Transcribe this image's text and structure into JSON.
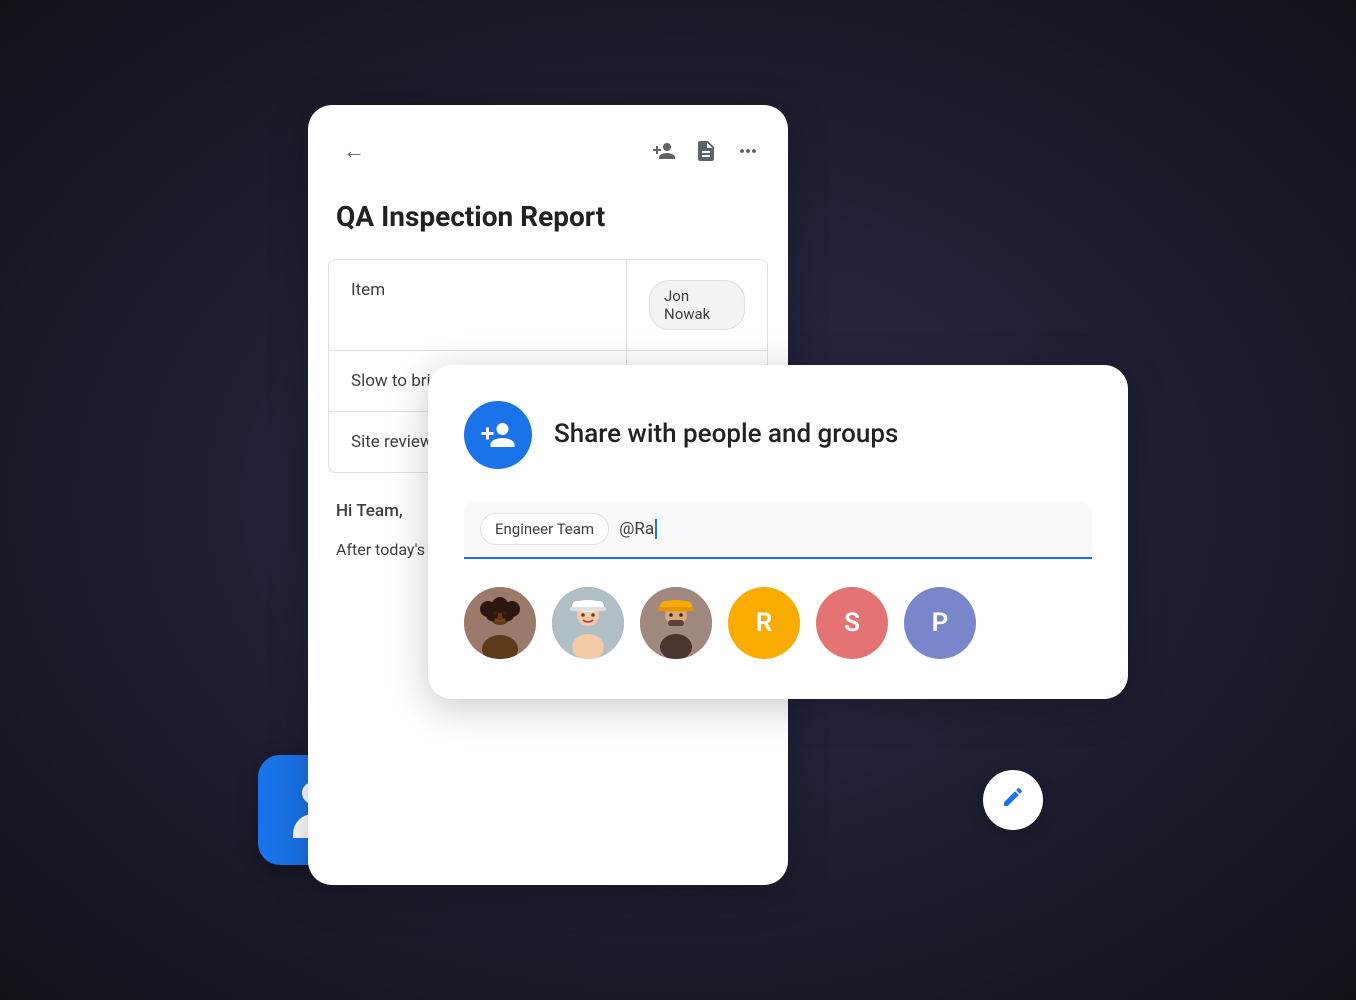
{
  "scene": {
    "background": "#1a1a2e"
  },
  "doc_card": {
    "title": "QA Inspection Report",
    "table": {
      "rows": [
        {
          "left": "Item",
          "right": "Jon Nowak"
        },
        {
          "left": "Slow to bri",
          "right": ""
        },
        {
          "left": "Site review",
          "right": ""
        }
      ]
    },
    "body": {
      "greeting": "Hi Team,",
      "text": "After today's please add y working doc before next week."
    },
    "fab_label": "✏"
  },
  "share_dialog": {
    "title": "Share with people and groups",
    "input": {
      "tag": "Engineer Team",
      "typed": "@Ra"
    },
    "avatars": [
      {
        "type": "photo",
        "id": "avatar1",
        "label": "Person 1",
        "color": "#bdbdbd"
      },
      {
        "type": "photo",
        "id": "avatar2",
        "label": "Person 2",
        "color": "#9e9e9e"
      },
      {
        "type": "photo",
        "id": "avatar3",
        "label": "Person 3",
        "color": "#8d6e63"
      },
      {
        "type": "letter",
        "letter": "R",
        "color": "#f9ab00"
      },
      {
        "type": "letter",
        "letter": "S",
        "color": "#e57373"
      },
      {
        "type": "letter",
        "letter": "P",
        "color": "#7986cb"
      }
    ]
  },
  "blue_card": {
    "label": "People icon"
  },
  "icons": {
    "back_arrow": "←",
    "add_person": "person_add",
    "doc_icon": "description",
    "more": "•••",
    "edit": "✏"
  }
}
